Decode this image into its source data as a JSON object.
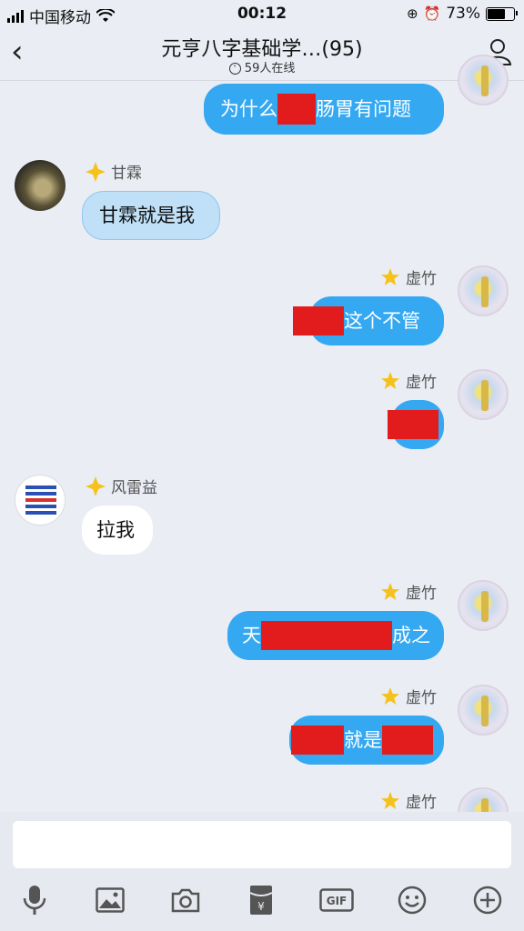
{
  "status": {
    "carrier": "中国移动",
    "time": "00:12",
    "battery": "73%",
    "battery_level": 0.73
  },
  "header": {
    "title": "元亨八字基础学…(95)",
    "online": "59人在线"
  },
  "messages": [
    {
      "sender": "",
      "text_before": "为什么",
      "text_after": "肠胃有问题"
    },
    {
      "sender": "甘霖",
      "text": "甘霖就是我"
    },
    {
      "sender": "虚竹",
      "text": "这个不管"
    },
    {
      "sender": "虚竹",
      "text": ""
    },
    {
      "sender": "风雷益",
      "text": "拉我"
    },
    {
      "sender": "虚竹",
      "text_before": "天",
      "text_after": "成之"
    },
    {
      "sender": "虚竹",
      "text_middle": "就是"
    },
    {
      "sender": "虚竹"
    }
  ],
  "icons": [
    "back-icon",
    "profile-icon",
    "microphone-icon",
    "image-icon",
    "camera-icon",
    "red-packet-icon",
    "gif-icon",
    "emoji-icon",
    "plus-icon"
  ],
  "colors": {
    "outgoing": "#35a8f2",
    "redaction": "#e21c1c",
    "star": "#f5c21b"
  }
}
